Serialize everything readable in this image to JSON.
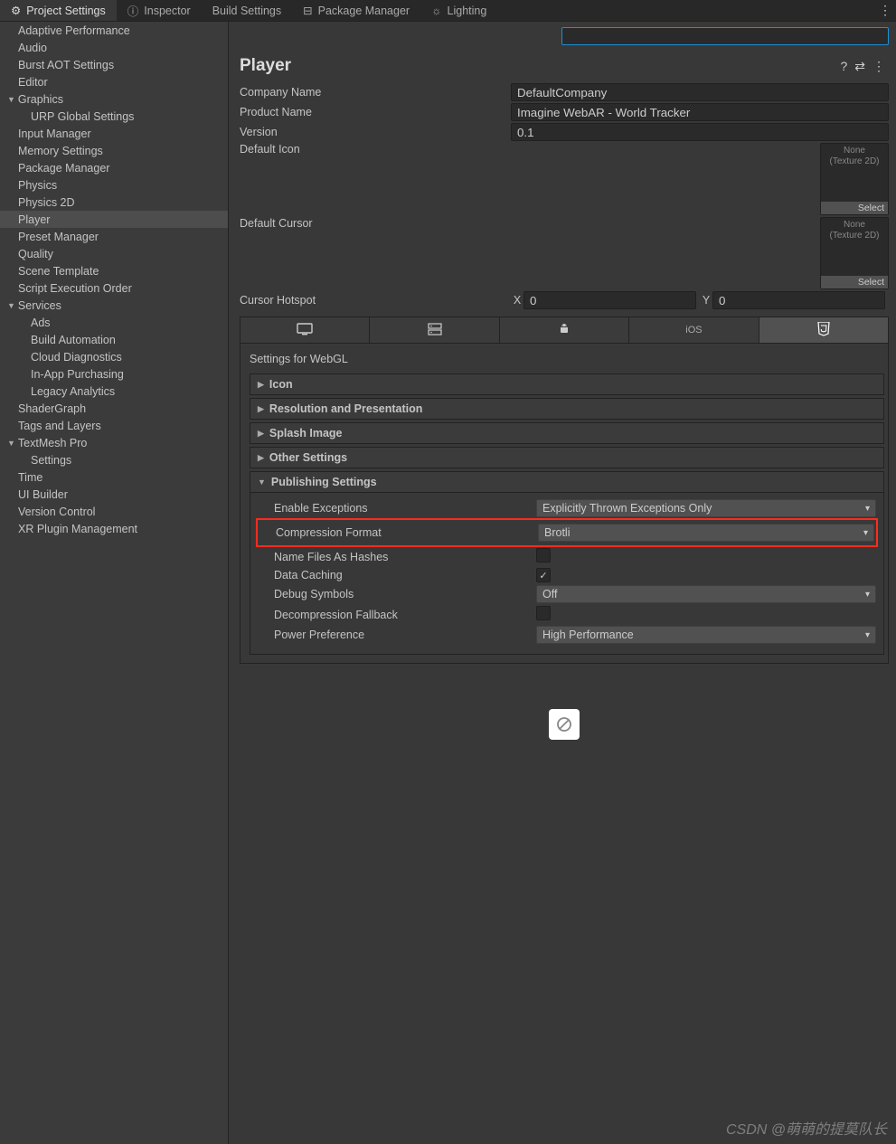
{
  "tabs": {
    "projectSettings": "Project Settings",
    "inspector": "Inspector",
    "buildSettings": "Build Settings",
    "packageManager": "Package Manager",
    "lighting": "Lighting"
  },
  "sidebar": {
    "adaptivePerformance": "Adaptive Performance",
    "audio": "Audio",
    "burstAOT": "Burst AOT Settings",
    "editor": "Editor",
    "graphics": "Graphics",
    "urpGlobal": "URP Global Settings",
    "inputManager": "Input Manager",
    "memorySettings": "Memory Settings",
    "packageManager": "Package Manager",
    "physics": "Physics",
    "physics2D": "Physics 2D",
    "player": "Player",
    "presetManager": "Preset Manager",
    "quality": "Quality",
    "sceneTemplate": "Scene Template",
    "scriptExecutionOrder": "Script Execution Order",
    "services": "Services",
    "ads": "Ads",
    "buildAutomation": "Build Automation",
    "cloudDiagnostics": "Cloud Diagnostics",
    "inAppPurchasing": "In-App Purchasing",
    "legacyAnalytics": "Legacy Analytics",
    "shaderGraph": "ShaderGraph",
    "tagsAndLayers": "Tags and Layers",
    "textMeshPro": "TextMesh Pro",
    "textMeshSettings": "Settings",
    "time": "Time",
    "uiBuilder": "UI Builder",
    "versionControl": "Version Control",
    "xrPlugin": "XR Plugin Management"
  },
  "header": {
    "title": "Player"
  },
  "fields": {
    "companyNameLabel": "Company Name",
    "companyNameValue": "DefaultCompany",
    "productNameLabel": "Product Name",
    "productNameValue": "Imagine WebAR - World Tracker",
    "versionLabel": "Version",
    "versionValue": "0.1",
    "defaultIconLabel": "Default Icon",
    "defaultCursorLabel": "Default Cursor",
    "textureNone": "None",
    "textureType": "(Texture 2D)",
    "selectLabel": "Select",
    "cursorHotspotLabel": "Cursor Hotspot",
    "xLabel": "X",
    "yLabel": "Y",
    "xValue": "0",
    "yValue": "0"
  },
  "platforms": {
    "ios": "iOS"
  },
  "settings": {
    "settingsFor": "Settings for WebGL",
    "icon": "Icon",
    "resolution": "Resolution and Presentation",
    "splashImage": "Splash Image",
    "otherSettings": "Other Settings",
    "publishingSettings": "Publishing Settings"
  },
  "publishing": {
    "enableExceptionsLabel": "Enable Exceptions",
    "enableExceptionsValue": "Explicitly Thrown Exceptions Only",
    "compressionFormatLabel": "Compression Format",
    "compressionFormatValue": "Brotli",
    "nameFilesAsHashesLabel": "Name Files As Hashes",
    "dataCachingLabel": "Data Caching",
    "debugSymbolsLabel": "Debug Symbols",
    "debugSymbolsValue": "Off",
    "decompressionFallbackLabel": "Decompression Fallback",
    "powerPreferenceLabel": "Power Preference",
    "powerPreferenceValue": "High Performance"
  },
  "watermark": "CSDN @萌萌的提莫队长"
}
